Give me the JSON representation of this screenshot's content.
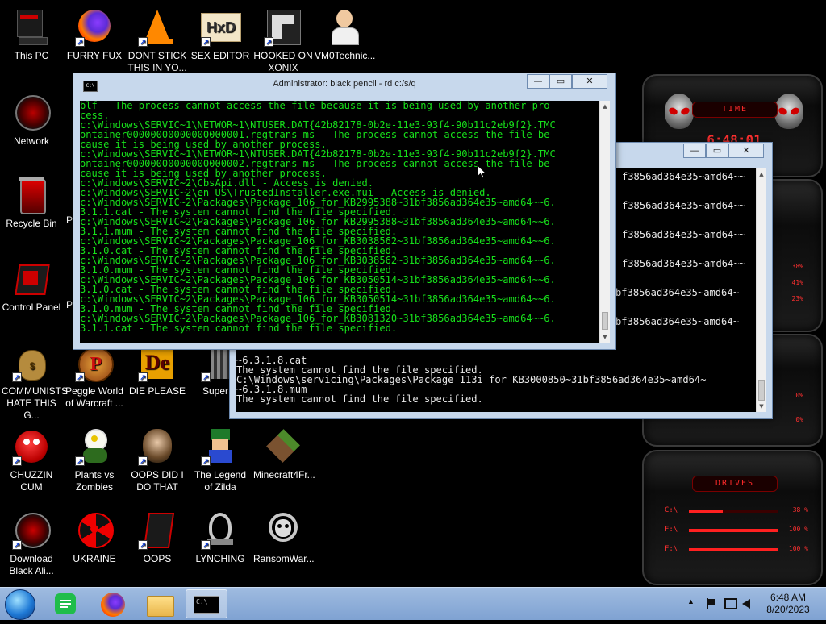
{
  "desktop_icons": [
    {
      "id": "this-pc",
      "label": "This PC",
      "icon": "computer-icon"
    },
    {
      "id": "furry-fux",
      "label": "FURRY FUX",
      "icon": "firefox-icon"
    },
    {
      "id": "dont-stick",
      "label": "DONT STICK THIS IN YO...",
      "icon": "vlc-cone-icon"
    },
    {
      "id": "sex-editor",
      "label": "SEX EDITOR",
      "icon": "hxd-editor-icon"
    },
    {
      "id": "hooked",
      "label": "HOOKED ON XONIX",
      "icon": "xonix-icon"
    },
    {
      "id": "vm0",
      "label": "VM0Technic...",
      "icon": "doctor-avatar-icon"
    },
    {
      "id": "network",
      "label": "Network",
      "icon": "alien-network-icon"
    },
    {
      "id": "recycle",
      "label": "Recycle Bin",
      "icon": "recycle-bin-icon"
    },
    {
      "id": "control-panel",
      "label": "Control Panel",
      "icon": "control-panel-icon"
    },
    {
      "id": "communists",
      "label": "COMMUNISTS HATE THIS G...",
      "icon": "money-bag-icon"
    },
    {
      "id": "peggle",
      "label": "Peggle World of Warcraft ...",
      "icon": "peggle-icon"
    },
    {
      "id": "die-please",
      "label": "DIE PLEASE",
      "icon": "de-icon"
    },
    {
      "id": "super-h",
      "label": "Super H",
      "icon": "pixel-game-icon"
    },
    {
      "id": "chuzzin",
      "label": "CHUZZIN CUM",
      "icon": "chuzzle-icon"
    },
    {
      "id": "pvz",
      "label": "Plants vs Zombies",
      "icon": "plant-icon"
    },
    {
      "id": "oops-did",
      "label": "OOPS DID I DO THAT",
      "icon": "portrait-icon"
    },
    {
      "id": "zilda",
      "label": "The Legend of Zilda",
      "icon": "pixel-hero-icon"
    },
    {
      "id": "minecraft",
      "label": "Minecraft4Fr...",
      "icon": "grass-block-icon"
    },
    {
      "id": "download-alien",
      "label": "Download Black Ali...",
      "icon": "alien-download-icon"
    },
    {
      "id": "ukraine",
      "label": "UKRAINE",
      "icon": "radiation-icon"
    },
    {
      "id": "oops",
      "label": "OOPS",
      "icon": "alien-oops-icon"
    },
    {
      "id": "lynching",
      "label": "LYNCHING",
      "icon": "rope-icon"
    },
    {
      "id": "ransomware",
      "label": "RansomWar...",
      "icon": "skull-icon"
    }
  ],
  "front_window": {
    "title": "Administrator:  black pencil - rd  c:/s/q",
    "controls": {
      "minimize": "—",
      "maximize": "▭",
      "close": "✕"
    },
    "lines": [
      "blf - The process cannot access the file because it is being used by another pro",
      "cess.",
      "c:\\Windows\\SERVIC~1\\NETWOR~1\\NTUSER.DAT{42b82178-0b2e-11e3-93f4-90b11c2eb9f2}.TMC",
      "ontainer00000000000000000001.regtrans-ms - The process cannot access the file be",
      "cause it is being used by another process.",
      "c:\\Windows\\SERVIC~1\\NETWOR~1\\NTUSER.DAT{42b82178-0b2e-11e3-93f4-90b11c2eb9f2}.TMC",
      "ontainer00000000000000000002.regtrans-ms - The process cannot access the file be",
      "cause it is being used by another process.",
      "c:\\Windows\\SERVIC~2\\CbsApi.dll - Access is denied.",
      "c:\\Windows\\SERVIC~2\\en-US\\TrustedInstaller.exe.mui - Access is denied.",
      "c:\\Windows\\SERVIC~2\\Packages\\Package_106_for_KB2995388~31bf3856ad364e35~amd64~~6.",
      "3.1.1.cat - The system cannot find the file specified.",
      "c:\\Windows\\SERVIC~2\\Packages\\Package_106_for_KB2995388~31bf3856ad364e35~amd64~~6.",
      "3.1.1.mum - The system cannot find the file specified.",
      "c:\\Windows\\SERVIC~2\\Packages\\Package_106_for_KB3038562~31bf3856ad364e35~amd64~~6.",
      "3.1.0.cat - The system cannot find the file specified.",
      "c:\\Windows\\SERVIC~2\\Packages\\Package_106_for_KB3038562~31bf3856ad364e35~amd64~~6.",
      "3.1.0.mum - The system cannot find the file specified.",
      "c:\\Windows\\SERVIC~2\\Packages\\Package_106_for_KB3050514~31bf3856ad364e35~amd64~~6.",
      "3.1.0.cat - The system cannot find the file specified.",
      "c:\\Windows\\SERVIC~2\\Packages\\Package_106_for_KB3050514~31bf3856ad364e35~amd64~~6.",
      "3.1.0.mum - The system cannot find the file specified.",
      "c:\\Windows\\SERVIC~2\\Packages\\Package_106_for_KB3081320~31bf3856ad364e35~amd64~~6.",
      "3.1.1.cat - The system cannot find the file specified."
    ]
  },
  "back_window": {
    "controls": {
      "minimize": "—",
      "maximize": "▭",
      "close": "✕"
    },
    "right_fragments": [
      "f3856ad364e35~amd64~~",
      "f3856ad364e35~amd64~~",
      "f3856ad364e35~amd64~~",
      "f3856ad364e35~amd64~~",
      "bf3856ad364e35~amd64~",
      "bf3856ad364e35~amd64~"
    ],
    "bottom_lines": [
      "~6.3.1.8.cat",
      "The system cannot find the file specified.",
      "C:\\Windows\\servicing\\Packages\\Package_113i_for_KB3000850~31bf3856ad364e35~amd64~",
      "~6.3.1.8.mum",
      "The system cannot find the file specified."
    ]
  },
  "alien_widget": {
    "time_label": "TIME",
    "time": "6:48:01",
    "drives_label": "DRIVES",
    "cpu_percents": [
      "38%",
      "41%",
      "23%"
    ],
    "ram_percents": [
      "0%",
      "0%"
    ],
    "drives": [
      {
        "letter": "C:\\",
        "pct": "38 %",
        "fill": 0.38
      },
      {
        "letter": "F:\\",
        "pct": "100 %",
        "fill": 1.0
      },
      {
        "letter": "F:\\",
        "pct": "100 %",
        "fill": 1.0
      }
    ]
  },
  "taskbar": {
    "pinned": [
      {
        "id": "start",
        "icon": "windows-orb-icon"
      },
      {
        "id": "app1",
        "icon": "green-doc-icon"
      },
      {
        "id": "firefox",
        "icon": "firefox-icon"
      },
      {
        "id": "explorer",
        "icon": "folder-icon"
      },
      {
        "id": "cmd",
        "icon": "cmd-icon",
        "active": true
      }
    ],
    "tray_chevron": "▲",
    "time": "6:48 AM",
    "date": "8/20/2023"
  }
}
